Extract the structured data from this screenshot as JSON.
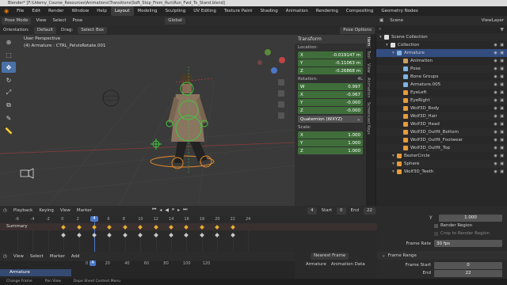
{
  "window_title": "Blender* [F:\\Udemy_Course_Resources\\Animations\\Transitions\\Soft_Stop_From_Run\\Run_Fwd_To_Stand.blend]",
  "menu": [
    "File",
    "Edit",
    "Render",
    "Window",
    "Help"
  ],
  "workspaces": [
    "Layout",
    "Modeling",
    "Sculpting",
    "UV Editing",
    "Texture Paint",
    "Shading",
    "Animation",
    "Rendering",
    "Compositing",
    "Geometry Nodes"
  ],
  "active_workspace": "Layout",
  "scene_label": "Scene",
  "viewlayer_label": "ViewLayer",
  "viewport_header": {
    "mode": "Pose Mode",
    "menus": [
      "View",
      "Select",
      "Pose"
    ],
    "orientation_label": "Orientation:",
    "orientation": "Default",
    "drag_label": "Drag:",
    "drag": "Select Box",
    "transform_orientation": "Global",
    "pose_options": "Pose Options"
  },
  "viewport": {
    "perspective": "User Perspective",
    "active": "(4) Armature : CTRL_PelvisRotate.001"
  },
  "tools": [
    {
      "icon": "cursor-icon",
      "active": false
    },
    {
      "icon": "select-box-icon",
      "active": false
    },
    {
      "icon": "move-icon",
      "active": true
    },
    {
      "icon": "rotate-icon",
      "active": false
    },
    {
      "icon": "scale-icon",
      "active": false
    },
    {
      "icon": "transform-icon",
      "active": false
    },
    {
      "icon": "annotate-icon",
      "active": false
    },
    {
      "icon": "measure-icon",
      "active": false
    }
  ],
  "npanel": {
    "title": "Transform",
    "location_label": "Location:",
    "location": [
      {
        "axis": "X",
        "value": "-0.019147 m"
      },
      {
        "axis": "Y",
        "value": "-0.11063 m"
      },
      {
        "axis": "Z",
        "value": "-0.26868 m"
      }
    ],
    "rotation_label": "Rotation:",
    "rotation_mode_hint": "4L",
    "rotation": [
      {
        "axis": "W",
        "value": "0.997"
      },
      {
        "axis": "X",
        "value": "-0.067"
      },
      {
        "axis": "Y",
        "value": "-0.000"
      },
      {
        "axis": "Z",
        "value": "-0.000"
      }
    ],
    "rotation_mode": "Quaternion (WXYZ)",
    "scale_label": "Scale:",
    "scale": [
      {
        "axis": "X",
        "value": "1.000"
      },
      {
        "axis": "Y",
        "value": "1.000"
      },
      {
        "axis": "Z",
        "value": "1.000"
      }
    ],
    "tabs": [
      "Item",
      "Tool",
      "View",
      "Animation",
      "Screencast Keys"
    ],
    "active_tab": "Item"
  },
  "outliner": {
    "rows": [
      {
        "label": "Scene Collection",
        "indent": 0,
        "icon_color": "#e0e0e0",
        "selected": false
      },
      {
        "label": "Collection",
        "indent": 1,
        "icon_color": "#e0e0e0",
        "selected": false
      },
      {
        "label": "Armature",
        "indent": 2,
        "icon_color": "#7fb2e5",
        "selected": true
      },
      {
        "label": "Animation",
        "indent": 3,
        "icon_color": "#c8a060",
        "selected": false
      },
      {
        "label": "Pose",
        "indent": 3,
        "icon_color": "#7fb2e5",
        "selected": false
      },
      {
        "label": "Bone Groups",
        "indent": 3,
        "icon_color": "#7fb2e5",
        "selected": false
      },
      {
        "label": "Armature.005",
        "indent": 3,
        "icon_color": "#7fb2e5",
        "selected": false
      },
      {
        "label": "EyeLeft",
        "indent": 3,
        "icon_color": "#e89a3c",
        "selected": false
      },
      {
        "label": "EyeRight",
        "indent": 3,
        "icon_color": "#e89a3c",
        "selected": false
      },
      {
        "label": "Wolf3D_Body",
        "indent": 3,
        "icon_color": "#e89a3c",
        "selected": false
      },
      {
        "label": "Wolf3D_Hair",
        "indent": 3,
        "icon_color": "#e89a3c",
        "selected": false
      },
      {
        "label": "Wolf3D_Head",
        "indent": 3,
        "icon_color": "#e89a3c",
        "selected": false
      },
      {
        "label": "Wolf3D_Outfit_Bottom",
        "indent": 3,
        "icon_color": "#e89a3c",
        "selected": false
      },
      {
        "label": "Wolf3D_Outfit_Footwear",
        "indent": 3,
        "icon_color": "#e89a3c",
        "selected": false
      },
      {
        "label": "Wolf3D_Outfit_Top",
        "indent": 3,
        "icon_color": "#e89a3c",
        "selected": false
      },
      {
        "label": "BezierCircle",
        "indent": 2,
        "icon_color": "#e89a3c",
        "selected": false
      },
      {
        "label": "Sphere",
        "indent": 2,
        "icon_color": "#e89a3c",
        "selected": false
      },
      {
        "label": "Wolf3D_Teeth",
        "indent": 2,
        "icon_color": "#e89a3c",
        "selected": false
      }
    ]
  },
  "timeline": {
    "menus": [
      "Playback",
      "Keying",
      "View",
      "Marker"
    ],
    "current_frame": "4",
    "start_label": "Start",
    "start": "0",
    "end_label": "End",
    "end": "22",
    "ticks": [
      "-6",
      "-4",
      "-2",
      "0",
      "2",
      "4",
      "6",
      "8",
      "10",
      "12",
      "14",
      "16",
      "18",
      "20",
      "22",
      "24"
    ],
    "summary_label": "Summary",
    "keyframes": [
      0,
      2,
      4,
      6,
      8,
      10,
      12,
      14,
      16,
      18,
      20,
      22
    ]
  },
  "dopesheet": {
    "menus": [
      "View",
      "Select",
      "Marker",
      "Add"
    ],
    "ticks": [
      "0",
      "20",
      "40",
      "60",
      "80",
      "100",
      "120"
    ],
    "current_frame": "4",
    "channel": "Armature",
    "nearest_frame": "Nearest Frame",
    "right_channels": [
      "Armature",
      "Animation Data"
    ]
  },
  "properties": {
    "y_label": "Y",
    "y_value": "1.000",
    "render_region": "Render Region",
    "crop": "Crop to Render Region",
    "frame_rate_label": "Frame Rate",
    "frame_rate": "30 fps",
    "frame_range": "Frame Range",
    "frame_start_label": "Frame Start",
    "frame_start": "0",
    "end_label": "End",
    "end": "22"
  },
  "status": [
    "Change Frame",
    "Pan View",
    "Dope Sheet Context Menu"
  ]
}
